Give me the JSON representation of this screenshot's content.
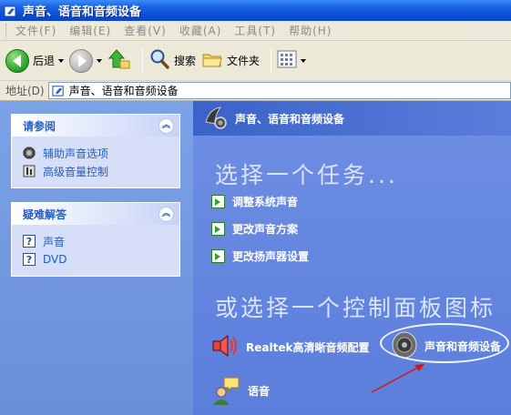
{
  "window": {
    "title": "声音、语音和音频设备"
  },
  "menu": [
    "文件(F)",
    "编辑(E)",
    "查看(V)",
    "收藏(A)",
    "工具(T)",
    "帮助(H)"
  ],
  "toolbar": {
    "back_label": "后退",
    "search_label": "搜索",
    "folders_label": "文件夹"
  },
  "address": {
    "label": "地址(D)",
    "value": "声音、语音和音频设备"
  },
  "see_also": {
    "title": "请参阅",
    "items": [
      "辅助声音选项",
      "高级音量控制"
    ]
  },
  "troubleshoot": {
    "title": "疑难解答",
    "items": [
      "声音",
      "DVD"
    ]
  },
  "main": {
    "category_title": "声音、语音和音频设备",
    "pick_task": "选择一个任务...",
    "tasks": [
      "调整系统声音",
      "更改声音方案",
      "更改扬声器设置"
    ],
    "pick_icon": "或选择一个控制面板图标",
    "icons": [
      "Realtek高清晰音频配置",
      "声音和音频设备",
      "语音"
    ]
  },
  "colors": {
    "title_bar": "#0a4fd8",
    "link": "#215dc6",
    "pane_blue": "#5b7edc",
    "annotation": "#d01818"
  }
}
